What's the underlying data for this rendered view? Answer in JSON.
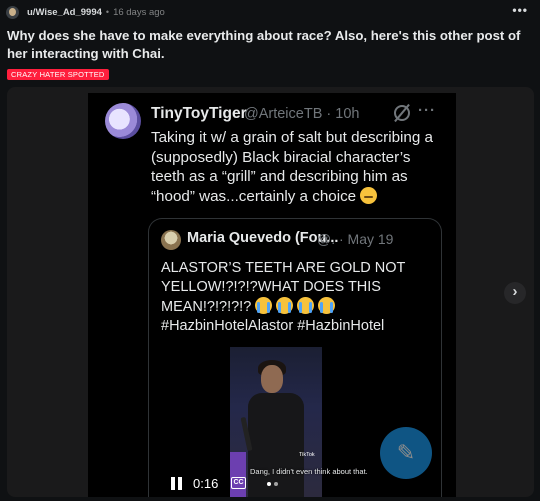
{
  "post": {
    "username": "u/Wise_Ad_9994",
    "separator": "•",
    "time": "16 days ago",
    "more": "•••",
    "title": "Why does she have to make everything about race? Also, here's this other post of her interacting with Chai.",
    "flair": "CRAZY HATER SPOTTED",
    "flair_color": "#ff1f3d"
  },
  "tweet": {
    "name": "TinyToyTiger",
    "handle": "@ArteiceTB · 10h",
    "more": "···",
    "text": "Taking it w/ a grain of salt but describing a (supposedly) Black biracial character’s teeth as a “grill” and describing him as “hood” was...certainly a choice",
    "text_emoji": "grimacing-sweat-emoji",
    "quote": {
      "name": "Maria Quevedo (Fou...",
      "handle": "@. · May 19",
      "text": "ALASTOR’S TEETH ARE GOLD NOT YELLOW!?!?!?WHAT DOES THIS MEAN!?!?!?!?",
      "hashtags": "#HazbinHotelAlastor #HazbinHotel"
    },
    "video": {
      "caption": "Dang, I didn't even think about that.",
      "watermark": "TikTok",
      "time": "0:16",
      "cc_label": "CC"
    }
  },
  "icons": {
    "compose": "compose-icon",
    "next": "chevron-right-icon"
  },
  "next_label": "›",
  "compose_label": "✎"
}
